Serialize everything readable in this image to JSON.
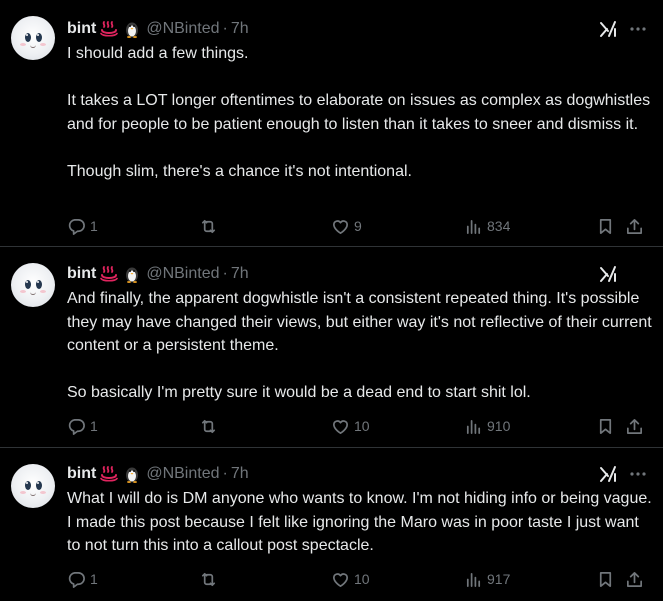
{
  "tweets": [
    {
      "name": "bint",
      "handle": "@NBinted",
      "separator": "·",
      "time": "7h",
      "paragraphs": [
        "I should add a few things.",
        "It takes a LOT longer oftentimes to elaborate on issues as complex as dogwhistles and for people to be patient enough to listen than it takes to sneer and dismiss it.",
        "Though slim, there's a chance it's not intentional."
      ],
      "replies": "1",
      "reposts": "",
      "likes": "9",
      "views": "834"
    },
    {
      "name": "bint",
      "handle": "@NBinted",
      "separator": "·",
      "time": "7h",
      "paragraphs": [
        "And finally, the apparent dogwhistle isn't a consistent repeated thing. It's possible they may have changed their views, but either way it's not reflective of their current content or a persistent theme.",
        "So basically I'm pretty sure it would be a dead end to start shit lol."
      ],
      "replies": "1",
      "reposts": "",
      "likes": "10",
      "views": "910"
    },
    {
      "name": "bint",
      "handle": "@NBinted",
      "separator": "·",
      "time": "7h",
      "paragraphs": [
        "What I will do is DM anyone who wants to know. I'm not hiding info or being vague. I made this post because I felt like ignoring the Maro was in poor taste I just want to not turn this into a callout post spectacle."
      ],
      "replies": "1",
      "reposts": "",
      "likes": "10",
      "views": "917"
    }
  ],
  "icons": {
    "name_emoji_1": "hot-springs-icon",
    "name_emoji_2": "penguin-icon",
    "top_right": "grok-icon",
    "menu": "more-icon",
    "actions": [
      "reply-icon",
      "repost-icon",
      "like-icon",
      "views-icon",
      "bookmark-icon",
      "share-icon"
    ]
  },
  "colors": {
    "background": "#000000",
    "text": "#e7e9ea",
    "secondary": "#71767b",
    "divider": "#2f3336",
    "hot_springs": "#e0245e"
  }
}
